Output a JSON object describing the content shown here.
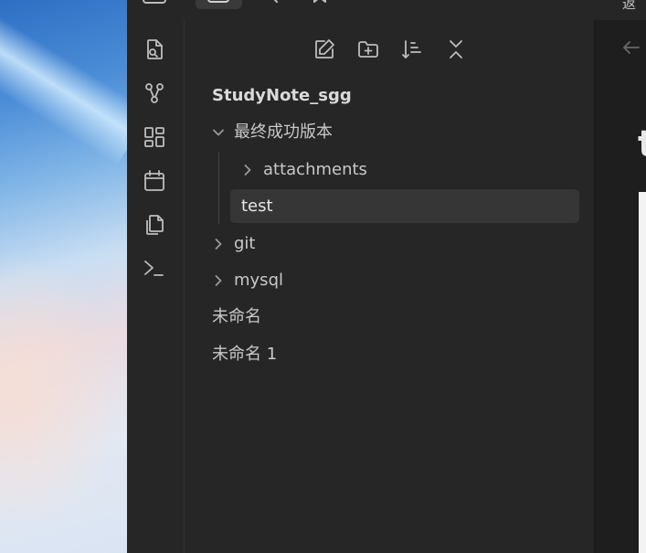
{
  "vault": {
    "name": "StudyNote_sgg"
  },
  "explorer": {
    "nav_buttons": [
      {
        "name": "new-note-icon"
      },
      {
        "name": "new-folder-icon"
      },
      {
        "name": "sort-icon"
      },
      {
        "name": "collapse-all-icon"
      }
    ],
    "tree": [
      {
        "label": "最终成功版本",
        "type": "folder",
        "expanded": true
      },
      {
        "label": "attachments",
        "type": "folder",
        "expanded": false
      },
      {
        "label": "test",
        "type": "file",
        "active": true
      },
      {
        "label": "git",
        "type": "folder",
        "expanded": false
      },
      {
        "label": "mysql",
        "type": "folder",
        "expanded": false
      },
      {
        "label": "未命名",
        "type": "file"
      },
      {
        "label": "未命名 1",
        "type": "file"
      }
    ]
  },
  "ribbon": {
    "items": [
      {
        "name": "quick-switcher-icon"
      },
      {
        "name": "graph-view-icon"
      },
      {
        "name": "canvas-icon"
      },
      {
        "name": "daily-note-icon"
      },
      {
        "name": "templates-icon"
      },
      {
        "name": "command-palette-icon"
      }
    ]
  },
  "editor": {
    "title_fragment": "t"
  },
  "titlebar": {
    "text_fragment": "返"
  },
  "colors": {
    "pane_bg": "#262626",
    "active_row_bg": "#363636",
    "text": "#c8c8c8",
    "icon": "#bdbdbd"
  }
}
